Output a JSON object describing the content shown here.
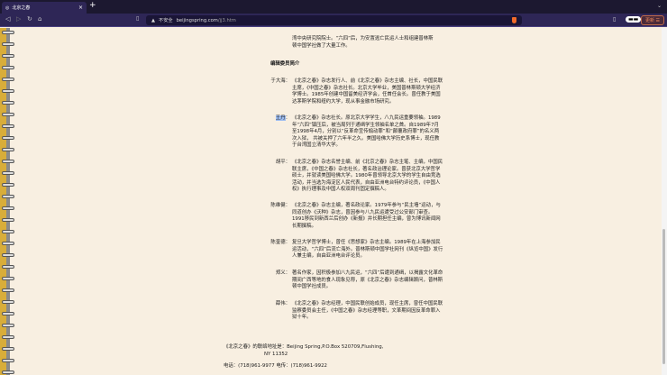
{
  "browser": {
    "tab_title": "北京之春",
    "tab_close": "×",
    "new_tab": "+",
    "security": "不安全",
    "url_domain": "beijingspring.com",
    "url_path": "/jj3.htm",
    "update_button": "更新 ☰"
  },
  "intro_lines": [
    "湾中央研究院院士。“六四”后，为安置逃亡民运人士和组建普林斯",
    "顿中国学社做了大量工作。"
  ],
  "section_title": "编辑委员简介",
  "members": [
    {
      "name": "于大海：",
      "bio": "《北京之春》杂志发行人、前《北京之春》杂志主编、社长，中国民联主席，《中国之春》杂志社长。北京大学毕业，美国普林斯顿大学经济学博士。1985年创建中国留美经济学会，任首任会长。曾任教于美国达茅斯学院和纽约大学，现从事金融市场研究。"
    },
    {
      "name": "王丹",
      "sep": "：",
      "bio": "《北京之春》杂志社长。原北京大学学生，八九民运重要领袖。1989年“六四”镇压后，被当局列于通缉学生领袖名单之首。自1989年7月至1998年4月，分别以“反革命宣传煽动罪”和“颠覆政府罪”的名义两次入狱， 共被关押了六年半之久。美国哈佛大学历史系博士，现任教于台湾国立清华大学。"
    },
    {
      "name": "胡平：",
      "bio": "《北京之春》杂志名誉主编、前《北京之春》杂志主笔、主编，中国民联主席，《中国之春》杂志社长，著名政治理论家。曾获北京大学哲学硕士，并就读美国哈佛大学。1980年曾领导北京大学的学生自由竞选活动，并当选为海淀区人民代表，自由亚洲电台特约评论员，《中国人权》执行理事及中国人权双周刊固定撰稿人。"
    },
    {
      "name": "陈维健：",
      "bio": "《北京之春》杂志主编，著名政论家。1979年参与“民主墙”运动，与同道创办《沃种》杂志，曾因参与八九民运遭受过公安部门审查。1991移民到新西兰后创办《新报》并长期担任主编，曾为博讯新闻网长期撰稿。"
    },
    {
      "name": "陈奎德：",
      "bio": "复旦大学哲学博士，曾任《思想家》杂志主编。1989年在上海参加民运活动，“六四”后流亡海外。普林斯顿中国学社网刊《纵览中国》发行人兼主编，自由亚洲电台评论员。"
    },
    {
      "name": "郑义：",
      "bio": "著名作家，因积极参加八九民运，“六四”后遭到通缉，以揭露文化革命期间广西等地的食人现象见称，原《北京之春》杂志编辑顾问，普林斯顿中国学社成员。"
    },
    {
      "name": "薛伟：",
      "bio": "《北京之春》杂志经理，中国民联创始成员，现任主席，曾任中国民联监察委员会主任，《中国之春》杂志经理等职，文革期间因反革命罪入狱十年。"
    }
  ],
  "footer": {
    "address_1": "《北京之春》的联络地址是：Beijing Spring,P.O.Box 520709,Flushing,",
    "address_2": "NY 11352",
    "phone": "电话：(718)961-9977  电传：(718)961-9922"
  }
}
